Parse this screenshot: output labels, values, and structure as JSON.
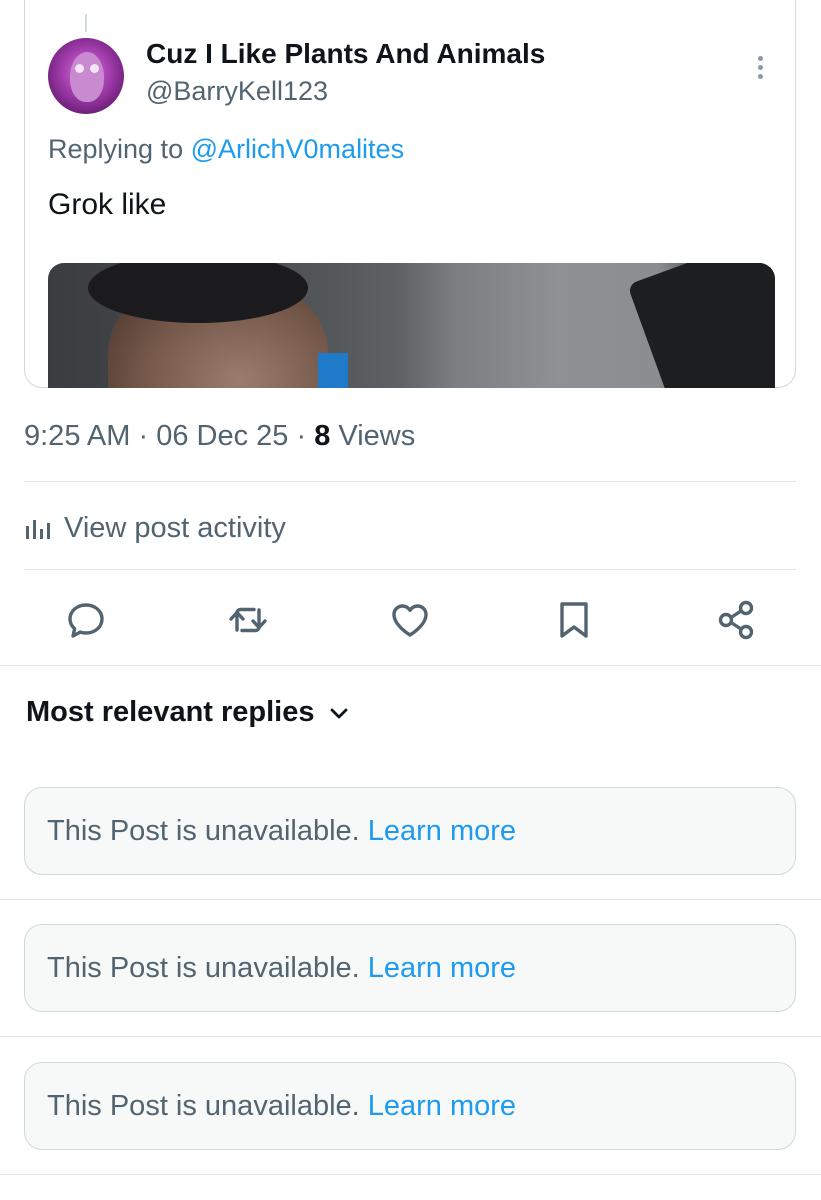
{
  "post": {
    "display_name": "Cuz I Like Plants And Animals",
    "handle": "@BarryKell123",
    "replying_prefix": "Replying to",
    "replying_to": "@ArlichV0malites",
    "text": "Grok like",
    "more_icon": "more-vertical-icon"
  },
  "meta": {
    "time": "9:25 AM",
    "date": "06 Dec 25",
    "separator": "·",
    "views_count": "8",
    "views_label": "Views"
  },
  "activity": {
    "icon": "analytics-icon",
    "label": "View post activity"
  },
  "actions": [
    {
      "name": "reply",
      "icon": "reply-icon"
    },
    {
      "name": "repost",
      "icon": "repost-icon"
    },
    {
      "name": "like",
      "icon": "heart-icon"
    },
    {
      "name": "bookmark",
      "icon": "bookmark-icon"
    },
    {
      "name": "share",
      "icon": "share-icon"
    }
  ],
  "replies": {
    "sort_label": "Most relevant replies",
    "sort_icon": "chevron-down-icon",
    "items": [
      {
        "text": "This Post is unavailable.",
        "link": "Learn more"
      },
      {
        "text": "This Post is unavailable.",
        "link": "Learn more"
      },
      {
        "text": "This Post is unavailable.",
        "link": "Learn more"
      }
    ]
  },
  "colors": {
    "accent": "#1d9bf0",
    "secondary_text": "#536471",
    "primary_text": "#0f1419",
    "border": "#cfd9de"
  }
}
